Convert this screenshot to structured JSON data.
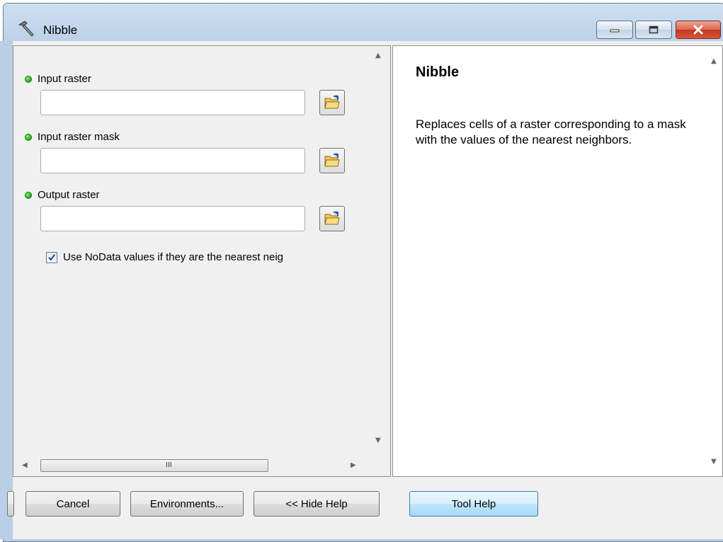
{
  "window": {
    "title": "Nibble",
    "icon": "hammer-icon",
    "controls": [
      "minimize-icon",
      "maximize-icon",
      "close-icon"
    ]
  },
  "parameters": [
    {
      "label": "Input raster",
      "value": "",
      "required_indicator": "green-dot"
    },
    {
      "label": "Input raster mask",
      "value": "",
      "required_indicator": "green-dot"
    },
    {
      "label": "Output raster",
      "value": "",
      "required_indicator": "green-dot"
    }
  ],
  "option": {
    "label": "Use NoData values if they are the nearest neig",
    "checked": true
  },
  "scrollbar": {
    "grip": "III"
  },
  "help": {
    "title": "Nibble",
    "body": "Replaces cells of a raster corresponding to a mask with the values of the nearest neighbors."
  },
  "buttons": {
    "cancel": "Cancel",
    "environments": "Environments...",
    "hide_help": "<< Hide Help",
    "tool_help": "Tool Help"
  },
  "colors": {
    "accent": "#3c7fb1",
    "required_dot": "#1ea21a",
    "close_button": "#c6371d"
  }
}
